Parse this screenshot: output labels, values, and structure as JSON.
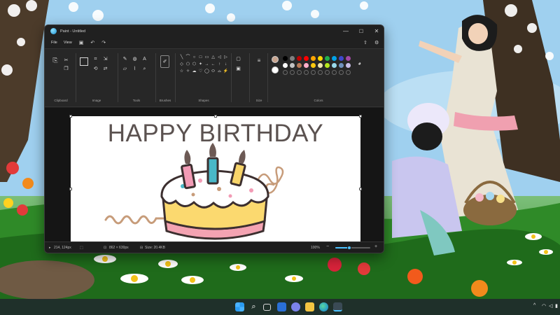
{
  "window": {
    "title": "Paint - Untitled",
    "controls": {
      "minimize": "—",
      "maximize": "☐",
      "close": "✕"
    }
  },
  "menu": {
    "file": "File",
    "view": "View",
    "save_icon": "save-icon",
    "undo_icon": "undo-icon",
    "redo_icon": "redo-icon",
    "share_icon": "share-icon",
    "settings_icon": "gear-icon"
  },
  "ribbon": {
    "groups": {
      "clipboard": "Clipboard",
      "image": "Image",
      "tools": "Tools",
      "brushes": "Brushes",
      "shapes": "Shapes",
      "size": "Size",
      "colors": "Colors"
    },
    "shape_glyphs": [
      "╲",
      "⌒",
      "○",
      "□",
      "▭",
      "△",
      "◁",
      "▷",
      "◇",
      "⬠",
      "⬡",
      "✦",
      "→",
      "←",
      "↑",
      "↓",
      "☆",
      "✧",
      "☁",
      "♡",
      "◯",
      "⬭",
      "⌓",
      "⚡"
    ],
    "primary_color": "#c9a590",
    "secondary_color": "#ffffff",
    "palette_row1": [
      "#000000",
      "#7f7f7f",
      "#c00000",
      "#ff0000",
      "#ffa500",
      "#ffd700",
      "#22b14c",
      "#00a2e8",
      "#3f48cc",
      "#a349a4"
    ],
    "palette_row2": [
      "#ffffff",
      "#c3c3c3",
      "#b97a57",
      "#ffaec9",
      "#ffc90e",
      "#efe4b0",
      "#b5e61d",
      "#99d9ea",
      "#7092be",
      "#c8bfe7"
    ],
    "palette_row3_count": 10
  },
  "canvas": {
    "heading": "HAPPY BIRTHDAY",
    "colors": {
      "frosting": "#ffffff",
      "cake": "#fbd96f",
      "base": "#f4a3b2",
      "outline": "#3c2f2f",
      "candle1": "#f29bb5",
      "candle2": "#49b8c8",
      "candle3": "#f8d56a",
      "flame": "#6d5a55",
      "squiggle": "#c79c7a"
    }
  },
  "status": {
    "cursor": "214, 124px",
    "selection_icon": "selection-icon",
    "dimensions": "862 × 630px",
    "size": "Size: 20.4KB",
    "zoom": "100%",
    "zoom_level": 0.4
  },
  "taskbar": {
    "icons": [
      "windows-start-icon",
      "search-icon",
      "task-view-icon",
      "widgets-icon",
      "chat-icon",
      "file-explorer-icon",
      "edge-icon",
      "paint-icon"
    ],
    "tray": {
      "chevron": "^",
      "wifi": "wifi-icon",
      "volume": "volume-icon",
      "battery": "battery-icon"
    }
  },
  "colors": {
    "accent": "#4cc2ff",
    "window_bg": "#202020",
    "ribbon_bg": "#272727"
  }
}
